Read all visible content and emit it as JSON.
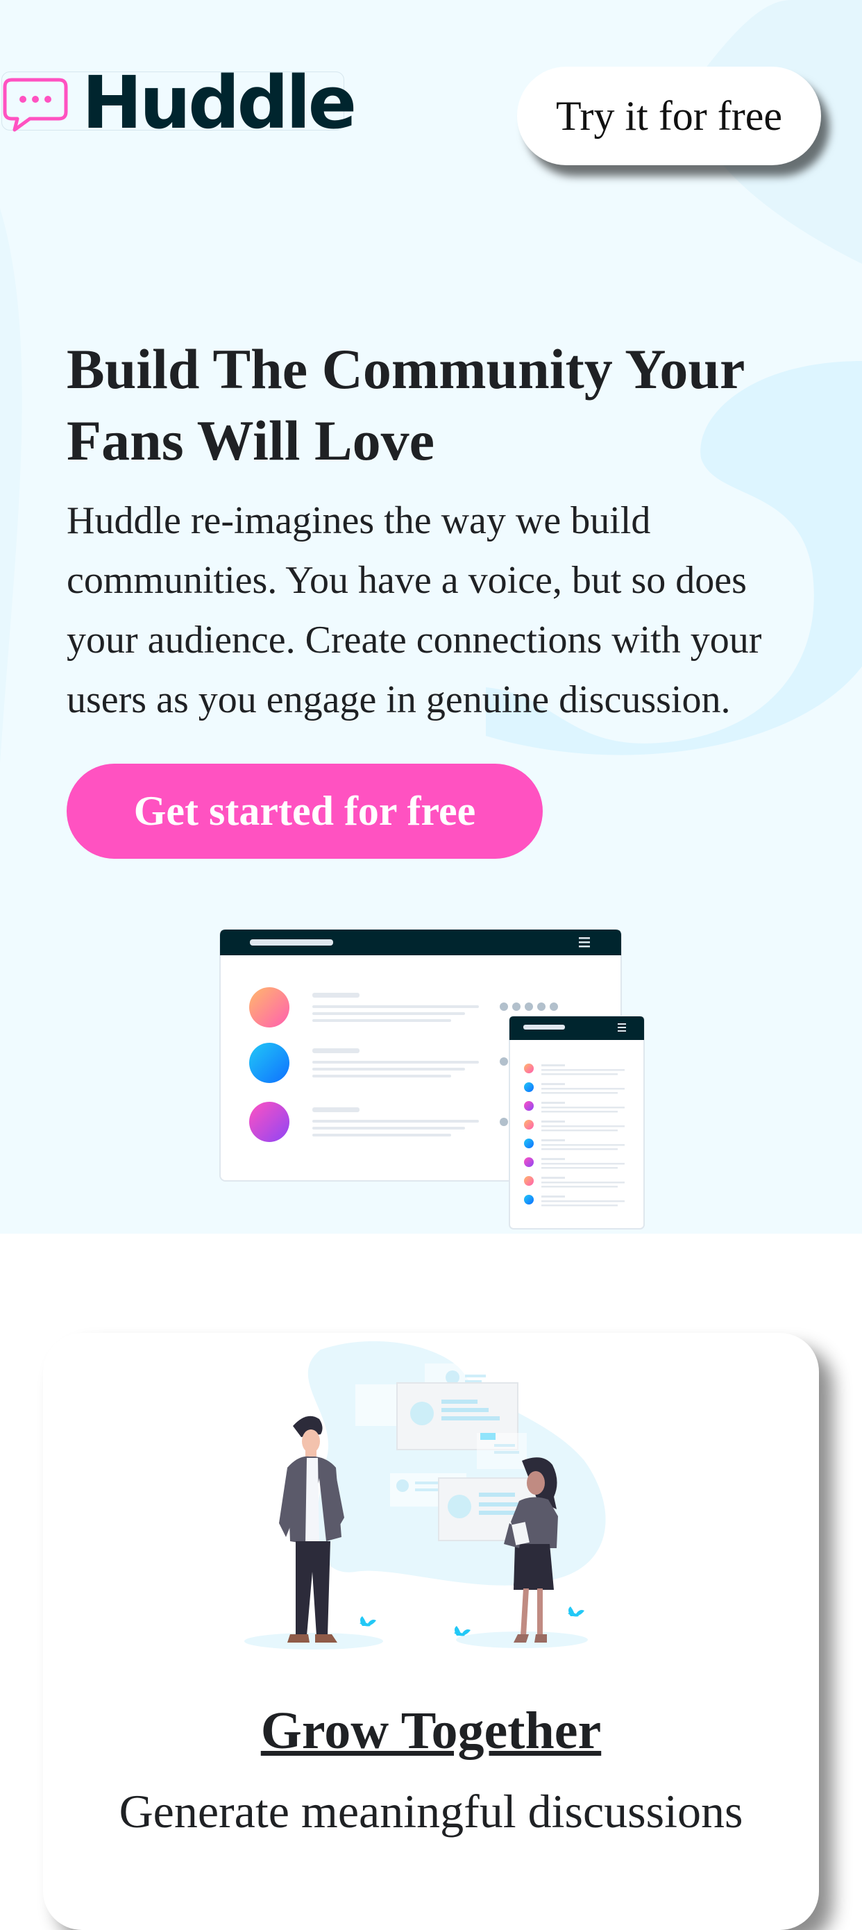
{
  "header": {
    "logo_text": "Huddle",
    "logo_icon": "chat-bubble-icon",
    "cta_label": "Try it for free"
  },
  "hero": {
    "headline": "Build The Community Your Fans Will Love",
    "description": "Huddle re-imagines the way we build communities. You have a voice, but so does your audience. Create connections with your users as you engage in genuine discussion.",
    "cta_label": "Get started for free"
  },
  "feature": {
    "title": "Grow Together",
    "text": "Generate meaningful discussions"
  },
  "colors": {
    "accent_pink": "#ff52c1",
    "dark_navy": "#00252e",
    "hero_bg": "#f0fbff",
    "light_cyan": "#ddf5ff"
  }
}
